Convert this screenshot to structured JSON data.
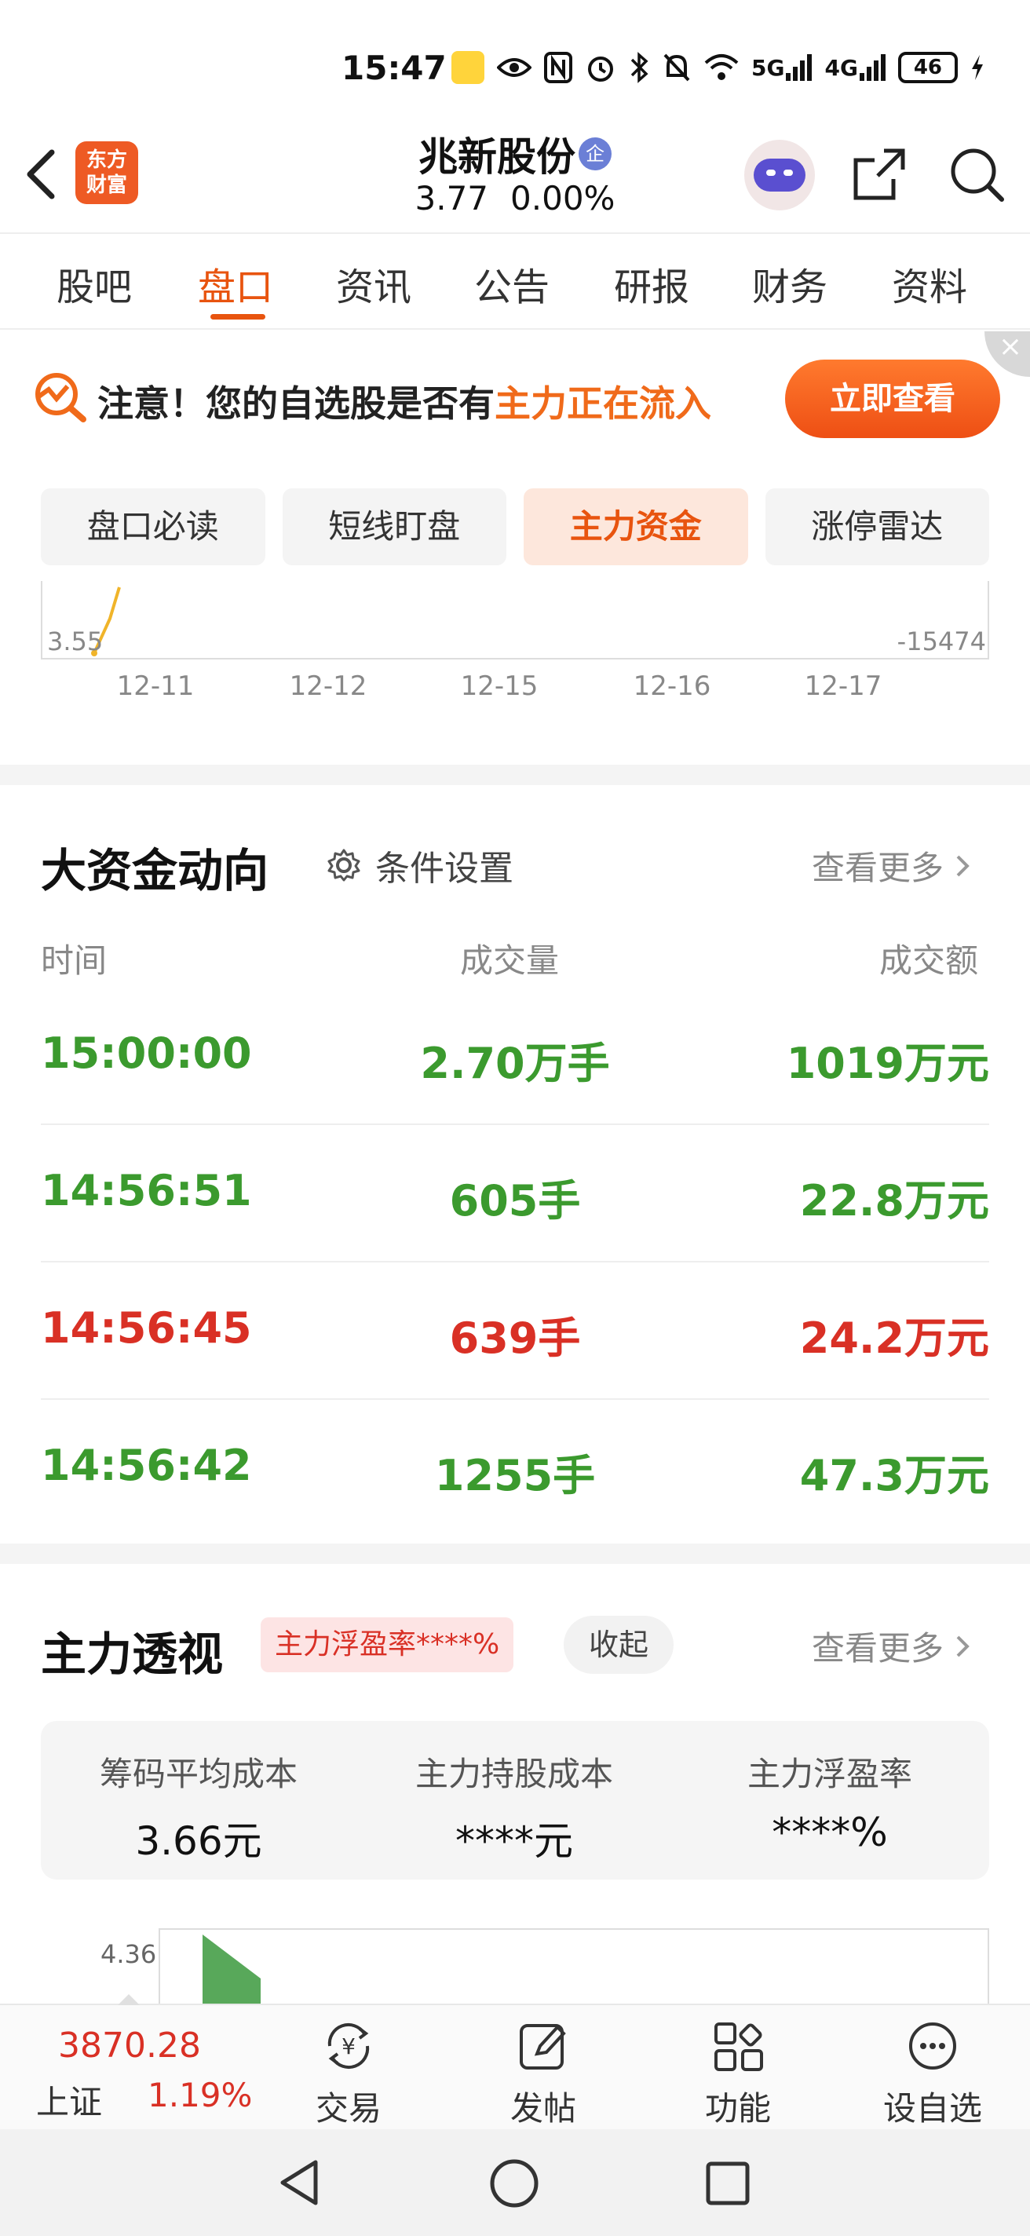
{
  "status_bar": {
    "time": "15:47",
    "network_5g": "5G",
    "network_4g": "4G",
    "battery": "46"
  },
  "header": {
    "app_logo_line1": "东方",
    "app_logo_line2": "财富",
    "stock_name": "兆新股份",
    "badge": "企",
    "price": "3.77",
    "change_pct": "0.00%"
  },
  "tabs": [
    {
      "label": "股吧"
    },
    {
      "label": "盘口"
    },
    {
      "label": "资讯"
    },
    {
      "label": "公告"
    },
    {
      "label": "研报"
    },
    {
      "label": "财务"
    },
    {
      "label": "资料"
    }
  ],
  "promo": {
    "prefix": "注意！您的自选股是否有",
    "highlight": "主力正在流入",
    "button": "立即查看",
    "close": "×"
  },
  "subtabs": [
    {
      "label": "盘口必读"
    },
    {
      "label": "短线盯盘"
    },
    {
      "label": "主力资金"
    },
    {
      "label": "涨停雷达"
    }
  ],
  "mini_chart": {
    "left_label": "3.55",
    "right_label": "-15474",
    "dates": [
      "12-11",
      "12-12",
      "12-15",
      "12-16",
      "12-17"
    ]
  },
  "big_capital": {
    "title": "大资金动向",
    "condition_settings": "条件设置",
    "see_more": "查看更多",
    "columns": {
      "time": "时间",
      "volume": "成交量",
      "amount": "成交额"
    },
    "rows": [
      {
        "time": "15:00:00",
        "volume": "2.70万手",
        "amount": "1019万元",
        "dir": "green"
      },
      {
        "time": "14:56:51",
        "volume": "605手",
        "amount": "22.8万元",
        "dir": "green"
      },
      {
        "time": "14:56:45",
        "volume": "639手",
        "amount": "24.2万元",
        "dir": "red"
      },
      {
        "time": "14:56:42",
        "volume": "1255手",
        "amount": "47.3万元",
        "dir": "green"
      }
    ]
  },
  "main_force": {
    "title": "主力透视",
    "badge": "主力浮盈率****%",
    "collapse": "收起",
    "see_more": "查看更多",
    "costs": [
      {
        "label": "筹码平均成本",
        "value": "3.66元"
      },
      {
        "label": "主力持股成本",
        "value": "****元"
      },
      {
        "label": "主力浮盈率",
        "value": "****%"
      }
    ],
    "chart_top_label": "4.36"
  },
  "bottom_bar": {
    "index_value": "3870.28",
    "index_name": "上证",
    "index_pct": "1.19%",
    "items": [
      {
        "label": "交易",
        "icon": "trade-icon"
      },
      {
        "label": "发帖",
        "icon": "post-icon"
      },
      {
        "label": "功能",
        "icon": "apps-icon"
      },
      {
        "label": "设自选",
        "icon": "more-icon"
      }
    ]
  },
  "colors": {
    "accent": "#e8540f",
    "up": "#d93025",
    "down": "#3b9a2e"
  }
}
